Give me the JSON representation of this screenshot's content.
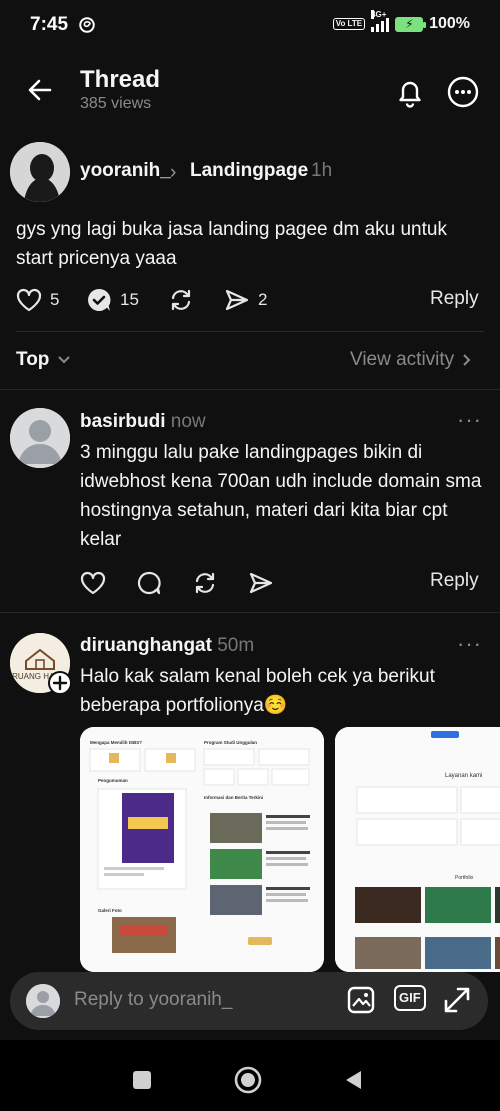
{
  "status": {
    "time": "7:45",
    "network": "4G+",
    "volte": "Vo LTE",
    "battery": "100%"
  },
  "header": {
    "title": "Thread",
    "views": "385 views"
  },
  "post": {
    "username": "yooranih_",
    "topic": "Landingpage",
    "time": "1h",
    "text": "gys yng lagi buka jasa landing pagee dm aku untuk start pricenya yaaa",
    "likes": "5",
    "comments": "15",
    "shares": "2",
    "reply_label": "Reply"
  },
  "sort": {
    "label": "Top",
    "view_activity": "View activity"
  },
  "comments": [
    {
      "username": "basirbudi",
      "time": "now",
      "text": "3 minggu lalu pake landingpages bikin di idwebhost kena 700an udh include domain sma hostingnya setahun, materi dari kita biar cpt kelar",
      "reply_label": "Reply"
    },
    {
      "username": "diruanghangat",
      "avatar_text": "DIRUANG HANGAT",
      "time": "50m",
      "text": "Halo kak salam kenal boleh cek ya berikut beberapa portfolionya☺️"
    }
  ],
  "thumbnails": {
    "first": {
      "col1_title": "Mengapa Memilih ISBS?",
      "col2_title": "Program Studi Unggulan",
      "section_a": "Pengumuman",
      "section_b": "Informasi dan Berita Terkini",
      "section_c": "Galeri Foto"
    },
    "second": {
      "section_a": "Layanan kami",
      "section_b": "Portfolio"
    }
  },
  "reply_bar": {
    "placeholder": "Reply to yooranih_",
    "gif_label": "GIF"
  },
  "colors": {
    "background": "#101010",
    "text": "#f3f5f7",
    "muted": "#8a8a8a",
    "battery": "#7be37d"
  }
}
